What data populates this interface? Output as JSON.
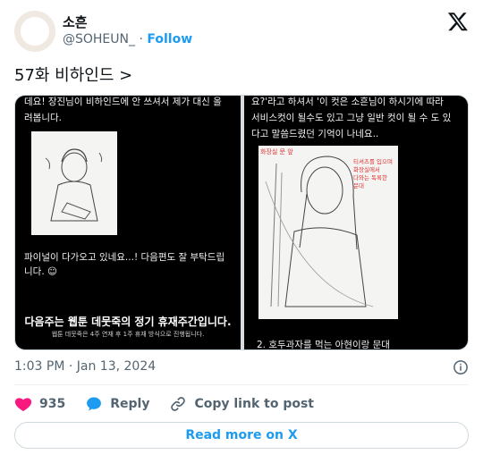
{
  "author": {
    "display_name": "소흔",
    "handle": "@SOHEUN_",
    "separator": "·",
    "follow_label": "Follow"
  },
  "tweet": {
    "text": "57화 비하인드 >",
    "timestamp": "1:03 PM · Jan 13, 2024"
  },
  "media": {
    "left": {
      "top_text_1": "데요! 장진님이 비하인드에 안 쓰셔서 제가 대신 올",
      "top_text_2": "려봅니다.",
      "mid_text_1": "파이널이 다가오고 있네요...! 다음편도 잘 부탁드립",
      "mid_text_2": "니다. ☺",
      "notice_title": "다음주는 웹툰 데뭇죽의 정기 휴재주간입니다.",
      "notice_sub": "웹툰 데뭇죽은 4주 연재 후 1주 휴재 방식으로 진행됩니다."
    },
    "right": {
      "top_text_1": "요?'라고 하셔서 '이 컷은 소흔님이 하시기에 따라",
      "top_text_2": "서비스컷이 될수도 있고 그냥 일반 컷이 될 수 도 있",
      "top_text_3": "다고 말씀드렸던 기억이 나네요..",
      "sketch_note_1": "화장실 문 앞",
      "sketch_note_2": "티셔츠를 입으며",
      "sketch_note_3": "화장실에서",
      "sketch_note_4": "다와는 독록한",
      "sketch_note_5": "문대",
      "bottom_text": "2. 호두과자를 먹는 아현이랑 문대"
    }
  },
  "actions": {
    "like_count": "935",
    "reply_label": "Reply",
    "copy_label": "Copy link to post"
  },
  "read_more_label": "Read more on X",
  "colors": {
    "accent": "#1d9bf0",
    "like": "#f91880",
    "text_secondary": "#536471"
  },
  "icons": [
    "x-logo-icon",
    "info-icon",
    "heart-icon",
    "reply-bubble-icon",
    "link-icon"
  ]
}
